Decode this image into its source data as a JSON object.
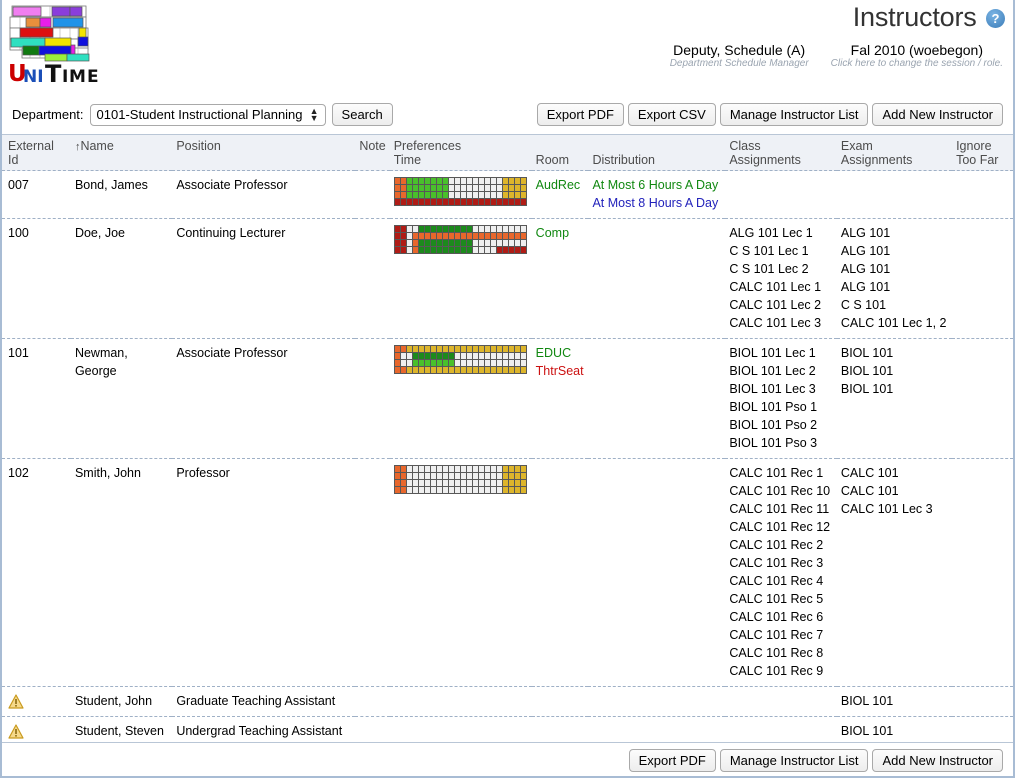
{
  "header": {
    "logo_alt": "UniTime",
    "logo_word": [
      "U",
      "NI",
      "T",
      "I",
      "M",
      "E"
    ],
    "page_title": "Instructors",
    "help_glyph": "?",
    "session": [
      {
        "main": "Deputy, Schedule (A)",
        "sub": "Department Schedule Manager"
      },
      {
        "main": "Fal 2010 (woebegon)",
        "sub": "Click here to change the session / role."
      }
    ]
  },
  "controls": {
    "department_label": "Department:",
    "department_value": "0101-Student Instructional Planning",
    "department_options": [
      "0101-Student Instructional Planning"
    ],
    "search_label": "Search",
    "buttons": [
      {
        "label": "Export PDF",
        "name": "export-pdf-button"
      },
      {
        "label": "Export CSV",
        "name": "export-csv-button"
      },
      {
        "label": "Manage Instructor List",
        "name": "manage-instructor-list-button"
      },
      {
        "label": "Add New Instructor",
        "name": "add-new-instructor-button"
      }
    ]
  },
  "table": {
    "headers": {
      "external_id": "External Id",
      "name": "Name",
      "name_sort_arrow": "↑",
      "position": "Position",
      "note": "Note",
      "preferences": "Preferences",
      "time": "Time",
      "room": "Room",
      "distribution": "Distribution",
      "class_assignments_1": "Class",
      "class_assignments_2": "Assignments",
      "exam_assignments_1": "Exam",
      "exam_assignments_2": "Assignments",
      "ignore_1": "Ignore",
      "ignore_2": "Too Far"
    },
    "rows": [
      {
        "external_id": "007",
        "name": "Bond, James",
        "position": "Associate Professor",
        "note": "",
        "warn": false,
        "room": [
          {
            "text": "AudRec",
            "color": "green"
          }
        ],
        "distribution": [
          {
            "text": "At Most 6 Hours A Day",
            "color": "green"
          },
          {
            "text": "At Most 8 Hours A Day",
            "color": "blue"
          }
        ],
        "class_assignments": [],
        "exam_assignments": [],
        "ignore_too_far": "",
        "time_grid": [
          [
            "org",
            "org",
            "green",
            "green",
            "green",
            "green",
            "green",
            "green",
            "green",
            "none",
            "none",
            "none",
            "none",
            "none",
            "none",
            "none",
            "none",
            "none",
            "yel",
            "yel",
            "yel",
            "yel"
          ],
          [
            "org",
            "org",
            "green",
            "green",
            "green",
            "green",
            "green",
            "green",
            "green",
            "none",
            "none",
            "none",
            "none",
            "none",
            "none",
            "none",
            "none",
            "none",
            "yel",
            "yel",
            "yel",
            "yel"
          ],
          [
            "org",
            "org",
            "green",
            "green",
            "green",
            "green",
            "green",
            "green",
            "green",
            "none",
            "none",
            "none",
            "none",
            "none",
            "none",
            "none",
            "none",
            "none",
            "yel",
            "yel",
            "yel",
            "yel"
          ],
          [
            "dred",
            "dred",
            "dred",
            "dred",
            "dred",
            "dred",
            "dred",
            "dred",
            "dred",
            "dred",
            "dred",
            "dred",
            "dred",
            "dred",
            "dred",
            "dred",
            "dred",
            "dred",
            "dred",
            "dred",
            "dred",
            "dred"
          ]
        ]
      },
      {
        "external_id": "100",
        "name": "Doe, Joe",
        "position": "Continuing Lecturer",
        "note": "",
        "warn": false,
        "room": [
          {
            "text": "Comp",
            "color": "green"
          }
        ],
        "distribution": [],
        "class_assignments": [
          "ALG 101 Lec 1",
          "C S 101 Lec 1",
          "C S 101 Lec 2",
          "CALC 101 Lec 1",
          "CALC 101 Lec 2",
          "CALC 101 Lec 3"
        ],
        "exam_assignments": [
          "ALG 101",
          "ALG 101",
          "ALG 101",
          "ALG 101",
          "C S 101",
          "CALC 101 Lec 1, 2"
        ],
        "ignore_too_far": "",
        "time_grid": [
          [
            "dred",
            "dred",
            "none",
            "none",
            "dgreen",
            "dgreen",
            "dgreen",
            "dgreen",
            "dgreen",
            "dgreen",
            "dgreen",
            "dgreen",
            "dgreen",
            "none",
            "none",
            "none",
            "none",
            "none",
            "none",
            "none",
            "none",
            "none"
          ],
          [
            "dred",
            "dred",
            "none",
            "org",
            "org",
            "org",
            "org",
            "org",
            "org",
            "org",
            "org",
            "org",
            "org",
            "org",
            "org",
            "org",
            "org",
            "org",
            "org",
            "org",
            "org",
            "org"
          ],
          [
            "dred",
            "dred",
            "none",
            "org",
            "dgreen",
            "dgreen",
            "dgreen",
            "dgreen",
            "dgreen",
            "dgreen",
            "dgreen",
            "dgreen",
            "dgreen",
            "none",
            "none",
            "none",
            "none",
            "none",
            "none",
            "none",
            "none",
            "none"
          ],
          [
            "dred",
            "dred",
            "none",
            "org",
            "dgreen",
            "dgreen",
            "dgreen",
            "dgreen",
            "dgreen",
            "dgreen",
            "dgreen",
            "dgreen",
            "dgreen",
            "none",
            "none",
            "none",
            "none",
            "dred",
            "dred",
            "dred",
            "dred",
            "dred"
          ]
        ]
      },
      {
        "external_id": "101",
        "name": "Newman, George",
        "position": "Associate Professor",
        "note": "",
        "warn": false,
        "room": [
          {
            "text": "EDUC",
            "color": "green"
          },
          {
            "text": "ThtrSeat",
            "color": "red"
          }
        ],
        "distribution": [],
        "class_assignments": [
          "BIOL 101 Lec 1",
          "BIOL 101 Lec 2",
          "BIOL 101 Lec 3",
          "BIOL 101 Pso 1",
          "BIOL 101 Pso 2",
          "BIOL 101 Pso 3"
        ],
        "exam_assignments": [
          "BIOL 101",
          "BIOL 101",
          "BIOL 101"
        ],
        "ignore_too_far": "",
        "time_grid": [
          [
            "org",
            "org",
            "yel",
            "yel",
            "yel",
            "yel",
            "yel",
            "yel",
            "yel",
            "yel",
            "yel",
            "yel",
            "yel",
            "yel",
            "yel",
            "yel",
            "yel",
            "yel",
            "yel",
            "yel",
            "yel",
            "yel"
          ],
          [
            "org",
            "none",
            "none",
            "dgreen",
            "dgreen",
            "dgreen",
            "dgreen",
            "dgreen",
            "dgreen",
            "dgreen",
            "none",
            "none",
            "none",
            "none",
            "none",
            "none",
            "none",
            "none",
            "none",
            "none",
            "none",
            "none"
          ],
          [
            "org",
            "none",
            "none",
            "green",
            "green",
            "green",
            "green",
            "green",
            "green",
            "green",
            "none",
            "none",
            "none",
            "none",
            "none",
            "none",
            "none",
            "none",
            "none",
            "none",
            "none",
            "none"
          ],
          [
            "org",
            "org",
            "yel",
            "yel",
            "yel",
            "yel",
            "yel",
            "yel",
            "yel",
            "yel",
            "yel",
            "yel",
            "yel",
            "yel",
            "yel",
            "yel",
            "yel",
            "yel",
            "yel",
            "yel",
            "yel",
            "yel"
          ]
        ]
      },
      {
        "external_id": "102",
        "name": "Smith, John",
        "position": "Professor",
        "note": "",
        "warn": false,
        "room": [],
        "distribution": [],
        "class_assignments": [
          "CALC 101 Rec 1",
          "CALC 101 Rec 10",
          "CALC 101 Rec 11",
          "CALC 101 Rec 12",
          "CALC 101 Rec 2",
          "CALC 101 Rec 3",
          "CALC 101 Rec 4",
          "CALC 101 Rec 5",
          "CALC 101 Rec 6",
          "CALC 101 Rec 7",
          "CALC 101 Rec 8",
          "CALC 101 Rec 9"
        ],
        "exam_assignments": [
          "CALC 101",
          "CALC 101",
          "CALC 101 Lec 3"
        ],
        "ignore_too_far": "",
        "time_grid": [
          [
            "org",
            "org",
            "none",
            "none",
            "none",
            "none",
            "none",
            "none",
            "none",
            "none",
            "none",
            "none",
            "none",
            "none",
            "none",
            "none",
            "none",
            "none",
            "yel",
            "yel",
            "yel",
            "yel"
          ],
          [
            "org",
            "org",
            "none",
            "none",
            "none",
            "none",
            "none",
            "none",
            "none",
            "none",
            "none",
            "none",
            "none",
            "none",
            "none",
            "none",
            "none",
            "none",
            "yel",
            "yel",
            "yel",
            "yel"
          ],
          [
            "org",
            "org",
            "none",
            "none",
            "none",
            "none",
            "none",
            "none",
            "none",
            "none",
            "none",
            "none",
            "none",
            "none",
            "none",
            "none",
            "none",
            "none",
            "yel",
            "yel",
            "yel",
            "yel"
          ],
          [
            "org",
            "org",
            "none",
            "none",
            "none",
            "none",
            "none",
            "none",
            "none",
            "none",
            "none",
            "none",
            "none",
            "none",
            "none",
            "none",
            "none",
            "none",
            "yel",
            "yel",
            "yel",
            "yel"
          ]
        ]
      },
      {
        "external_id": "",
        "name": "Student, John",
        "position": "Graduate Teaching Assistant",
        "note": "",
        "warn": true,
        "room": [],
        "distribution": [],
        "class_assignments": [],
        "exam_assignments": [
          "BIOL 101"
        ],
        "ignore_too_far": "",
        "time_grid": []
      },
      {
        "external_id": "",
        "name": "Student, Steven",
        "position": "Undergrad Teaching Assistant",
        "note": "",
        "warn": true,
        "room": [],
        "distribution": [],
        "class_assignments": [],
        "exam_assignments": [
          "BIOL 101"
        ],
        "ignore_too_far": "",
        "time_grid": []
      }
    ]
  },
  "footer": {
    "buttons": [
      {
        "label": "Export PDF",
        "name": "footer-export-pdf-button"
      },
      {
        "label": "Manage Instructor List",
        "name": "footer-manage-instructor-list-button"
      },
      {
        "label": "Add New Instructor",
        "name": "footer-add-new-instructor-button"
      }
    ]
  },
  "colors": {
    "accent": "#4f92cf",
    "green": "#118811",
    "red": "#cc1111",
    "blue": "#2222bb",
    "pref_green": "#49c02b",
    "pref_dgreen": "#1c8a1c",
    "pref_red": "#d52a22",
    "pref_orange": "#e8672c",
    "pref_yellow": "#ddb52b",
    "pref_none": "#efefef"
  }
}
